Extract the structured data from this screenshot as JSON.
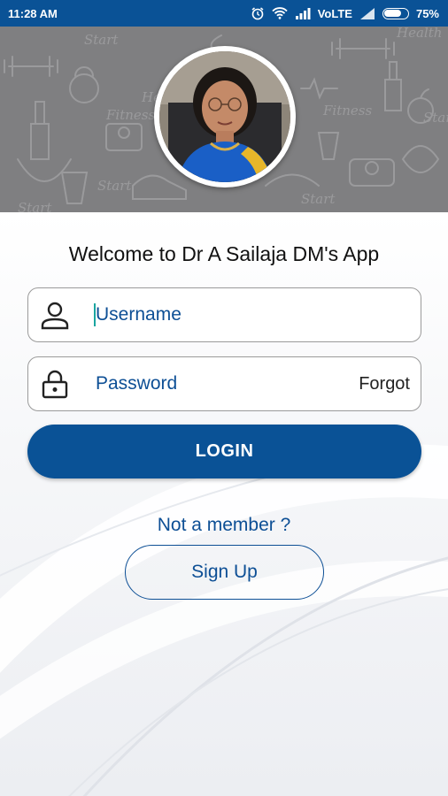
{
  "status_bar": {
    "time": "11:28 AM",
    "network": "VoLTE",
    "battery": "75%",
    "battery_level": 0.75,
    "icons": [
      "alarm-icon",
      "wifi-icon",
      "signal-icon",
      "battery-icon"
    ]
  },
  "header": {
    "avatar_alt": "Dr A Sailaja"
  },
  "login": {
    "welcome": "Welcome to Dr A Sailaja DM's App",
    "username_placeholder": "Username",
    "password_placeholder": "Password",
    "forgot_label": "Forgot",
    "login_label": "LOGIN",
    "not_member": "Not a member ?",
    "signup_label": "Sign Up"
  },
  "colors": {
    "primary": "#0a5296",
    "text_blue": "#0d4f95",
    "header_gray": "#7f7f81"
  }
}
